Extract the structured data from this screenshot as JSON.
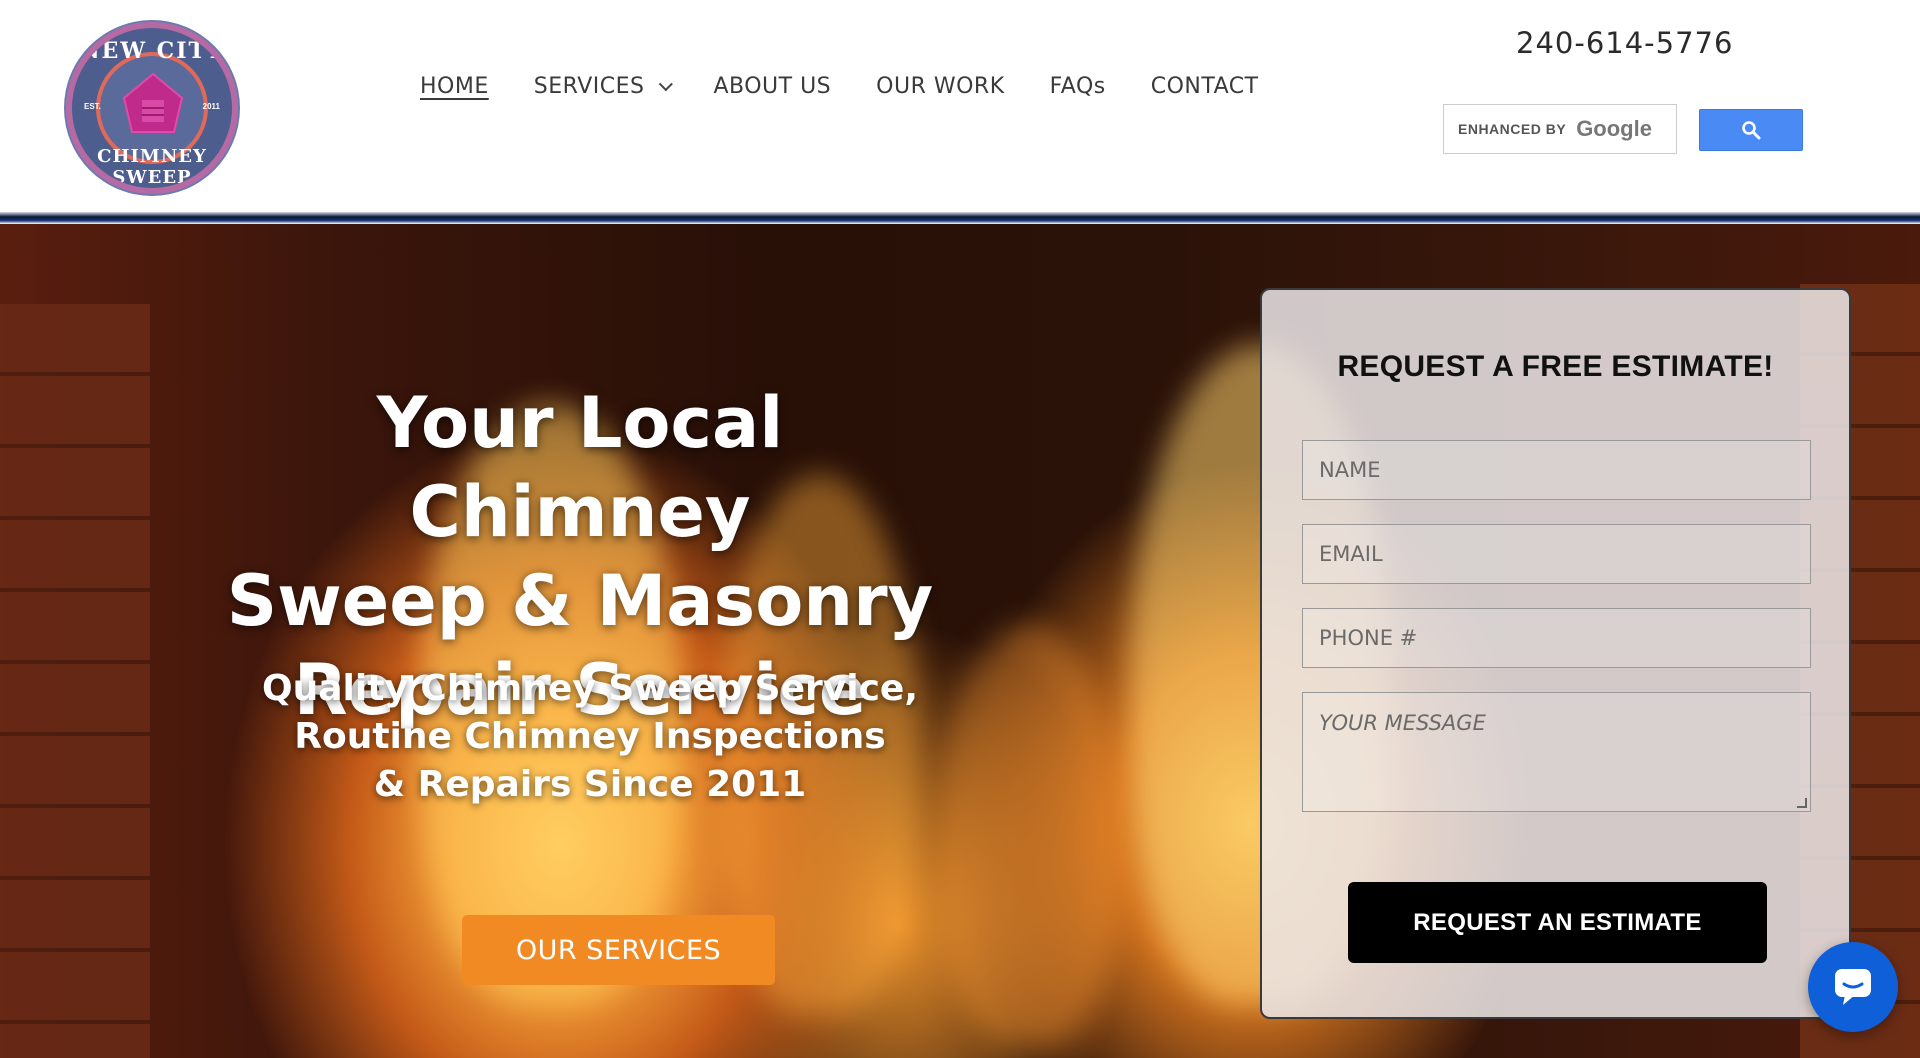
{
  "logo": {
    "top_text": "NEW CITY",
    "bottom_text": "CHIMNEY SWEEP",
    "est": "EST.",
    "year": "2011"
  },
  "nav": {
    "items": [
      {
        "label": "HOME",
        "active": true
      },
      {
        "label": "SERVICES",
        "has_dropdown": true
      },
      {
        "label": "ABOUT US"
      },
      {
        "label": "OUR WORK"
      },
      {
        "label": "FAQs"
      },
      {
        "label": "CONTACT"
      }
    ]
  },
  "header": {
    "phone": "240-614-5776",
    "search_enhanced": "ENHANCED BY",
    "search_brand": "Google",
    "search_icon": "search-icon"
  },
  "hero": {
    "title_lines": [
      "Your Local Chimney",
      "Sweep & Masonry",
      "Repair Service"
    ],
    "subtitle_lines": [
      "Quality Chimney Sweep Service,",
      "Routine Chimney Inspections",
      "& Repairs Since 2011"
    ],
    "cta_label": "OUR SERVICES"
  },
  "form": {
    "title": "REQUEST A FREE ESTIMATE!",
    "name_placeholder": "NAME",
    "email_placeholder": "EMAIL",
    "phone_placeholder": "PHONE #",
    "message_placeholder": "YOUR MESSAGE",
    "submit_label": "REQUEST AN ESTIMATE"
  },
  "chat": {
    "icon": "chat-bubble-icon"
  },
  "colors": {
    "accent_orange": "#f28a24",
    "search_blue": "#4a8af4",
    "chat_blue": "#0f5fd8"
  }
}
